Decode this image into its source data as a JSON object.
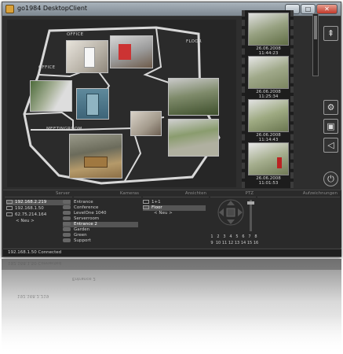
{
  "window": {
    "title": "go1984 DesktopClient",
    "btn_min": "_",
    "btn_max": "□",
    "btn_close": "✕"
  },
  "map": {
    "labels": {
      "office_top": "OFFICE",
      "floor": "FLOOR",
      "office_left": "OFFICE",
      "meetingroom": "MEETINGROOM"
    }
  },
  "recordings": [
    {
      "time": "26.06.2008 11:44:23"
    },
    {
      "time": "26.06.2008 11:25:34"
    },
    {
      "time": "26.06.2008 11:14:43"
    },
    {
      "time": "26.06.2008 11:01:53"
    }
  ],
  "sidebar_icons": [
    "scroll-up-icon",
    "settings-tool-icon",
    "snapshot-icon",
    "speaker-icon",
    "power-icon"
  ],
  "bottom": {
    "headers": {
      "server": "Server",
      "cameras": "Kameras",
      "views": "Ansichten",
      "ptz": "PTZ",
      "recordings": "Aufzeichnungen"
    },
    "servers": [
      {
        "label": "192.168.2.219",
        "selected": true
      },
      {
        "label": "192.168.1.50",
        "selected": false
      },
      {
        "label": "62.75.214.164",
        "selected": false
      },
      {
        "label": "< Neu >",
        "selected": false
      }
    ],
    "cameras": [
      {
        "label": "Entrance",
        "selected": false
      },
      {
        "label": "Conference",
        "selected": false
      },
      {
        "label": "LevelOne 1040",
        "selected": false
      },
      {
        "label": "Serverroom",
        "selected": false
      },
      {
        "label": "Entrance 2",
        "selected": true
      },
      {
        "label": "Garden",
        "selected": false
      },
      {
        "label": "Green",
        "selected": false
      },
      {
        "label": "Support",
        "selected": false
      }
    ],
    "views": [
      {
        "label": "1+1",
        "selected": false
      },
      {
        "label": "Floor",
        "selected": true
      },
      {
        "label": "< Neu >",
        "selected": false
      }
    ],
    "ptz_numbers": [
      "1",
      "2",
      "3",
      "4",
      "5",
      "6",
      "7",
      "8",
      "9",
      "10",
      "11",
      "12",
      "13",
      "14",
      "15",
      "16"
    ]
  },
  "status": {
    "text": "192.168.1.50 Connected"
  }
}
